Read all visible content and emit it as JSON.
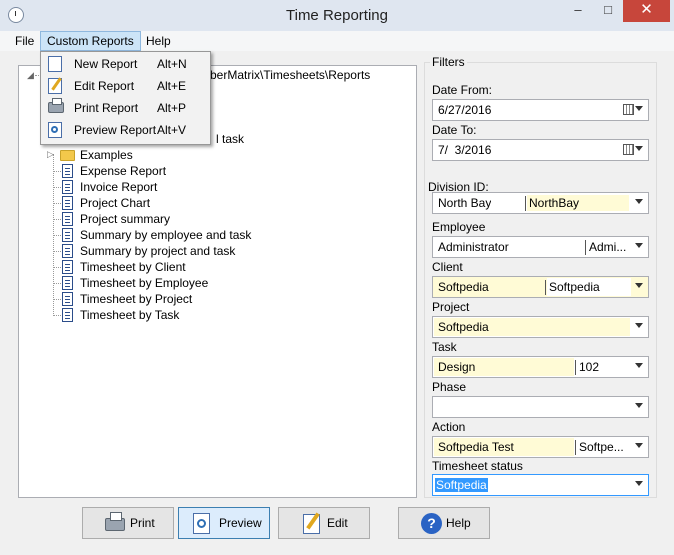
{
  "window": {
    "title": "Time Reporting",
    "minimize": "–",
    "maximize": "□",
    "close": "✕"
  },
  "menubar": {
    "file": "File",
    "custom_reports": "Custom Reports",
    "help": "Help"
  },
  "dropdown": [
    {
      "label": "New Report",
      "shortcut": "Alt+N",
      "icon": "new-doc-icon"
    },
    {
      "label": "Edit Report",
      "shortcut": "Alt+E",
      "icon": "edit-doc-icon"
    },
    {
      "label": "Print Report",
      "shortcut": "Alt+P",
      "icon": "printer-icon"
    },
    {
      "label": "Preview Report",
      "shortcut": "Alt+V",
      "icon": "preview-icon"
    }
  ],
  "tree": {
    "root_visible": "yberMatrix\\Timesheets\\Reports",
    "partial_item": "l task",
    "folder": "Examples",
    "items": [
      "Expense Report",
      "Invoice Report",
      "Project Chart",
      "Project summary",
      "Summary by employee and task",
      "Summary by project and task",
      "Timesheet by Client",
      "Timesheet by Employee",
      "Timesheet by Project",
      "Timesheet by Task"
    ]
  },
  "filters": {
    "title": "Filters",
    "date_from": {
      "label": "Date From:",
      "value": "6/27/2016"
    },
    "date_to": {
      "label": "Date To:",
      "value": "7/  3/2016"
    },
    "division": {
      "label": "Division ID:",
      "name": "North Bay",
      "code": "NorthBay"
    },
    "employee": {
      "label": "Employee",
      "name": "Administrator",
      "code": "Admi..."
    },
    "client": {
      "label": "Client",
      "name": "Softpedia",
      "code": "Softpedia"
    },
    "project": {
      "label": "Project",
      "name": "Softpedia"
    },
    "task": {
      "label": "Task",
      "name": "Design",
      "code": "102"
    },
    "phase": {
      "label": "Phase",
      "name": ""
    },
    "action": {
      "label": "Action",
      "name": "Softpedia Test",
      "code": "Softpe..."
    },
    "timesheet_status": {
      "label": "Timesheet status",
      "value": "Softpedia"
    }
  },
  "buttons": {
    "print": "Print",
    "preview": "Preview",
    "edit": "Edit",
    "help": "Help"
  }
}
